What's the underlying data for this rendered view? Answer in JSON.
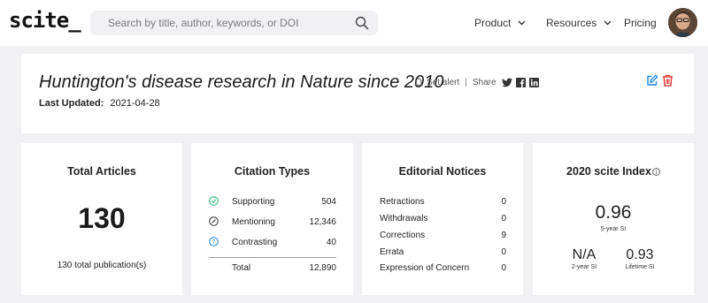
{
  "header": {
    "logo": "scite_",
    "search_placeholder": "Search by title, author, keywords, or DOI",
    "nav": {
      "product": "Product",
      "resources": "Resources",
      "pricing": "Pricing"
    }
  },
  "report": {
    "title": "Huntington's disease research in Nature since 2010",
    "set_alert": "Set alert",
    "separator": "|",
    "share": "Share",
    "last_updated_label": "Last Updated:",
    "last_updated_value": "2021-04-28"
  },
  "cards": {
    "total_articles": {
      "title": "Total Articles",
      "count": "130",
      "subtext": "130 total publication(s)"
    },
    "citation_types": {
      "title": "Citation Types",
      "rows": [
        {
          "label": "Supporting",
          "value": "504"
        },
        {
          "label": "Mentioning",
          "value": "12,346"
        },
        {
          "label": "Contrasting",
          "value": "40"
        }
      ],
      "total_label": "Total",
      "total_value": "12,890"
    },
    "editorial_notices": {
      "title": "Editorial Notices",
      "rows": [
        {
          "label": "Retractions",
          "value": "0"
        },
        {
          "label": "Withdrawals",
          "value": "0"
        },
        {
          "label": "Corrections",
          "value": "9"
        },
        {
          "label": "Errata",
          "value": "0"
        },
        {
          "label": "Expression of Concern",
          "value": "0"
        }
      ]
    },
    "scite_index": {
      "title": "2020 scite Index",
      "five_year_value": "0.96",
      "five_year_label": "5-year SI",
      "two_year_value": "N/A",
      "two_year_label": "2-year SI",
      "lifetime_value": "0.93",
      "lifetime_label": "Lifetime SI"
    }
  },
  "colors": {
    "supporting": "#2eb872",
    "contrasting": "#1e88e5",
    "edit": "#1e88e5",
    "delete": "#e53935"
  }
}
